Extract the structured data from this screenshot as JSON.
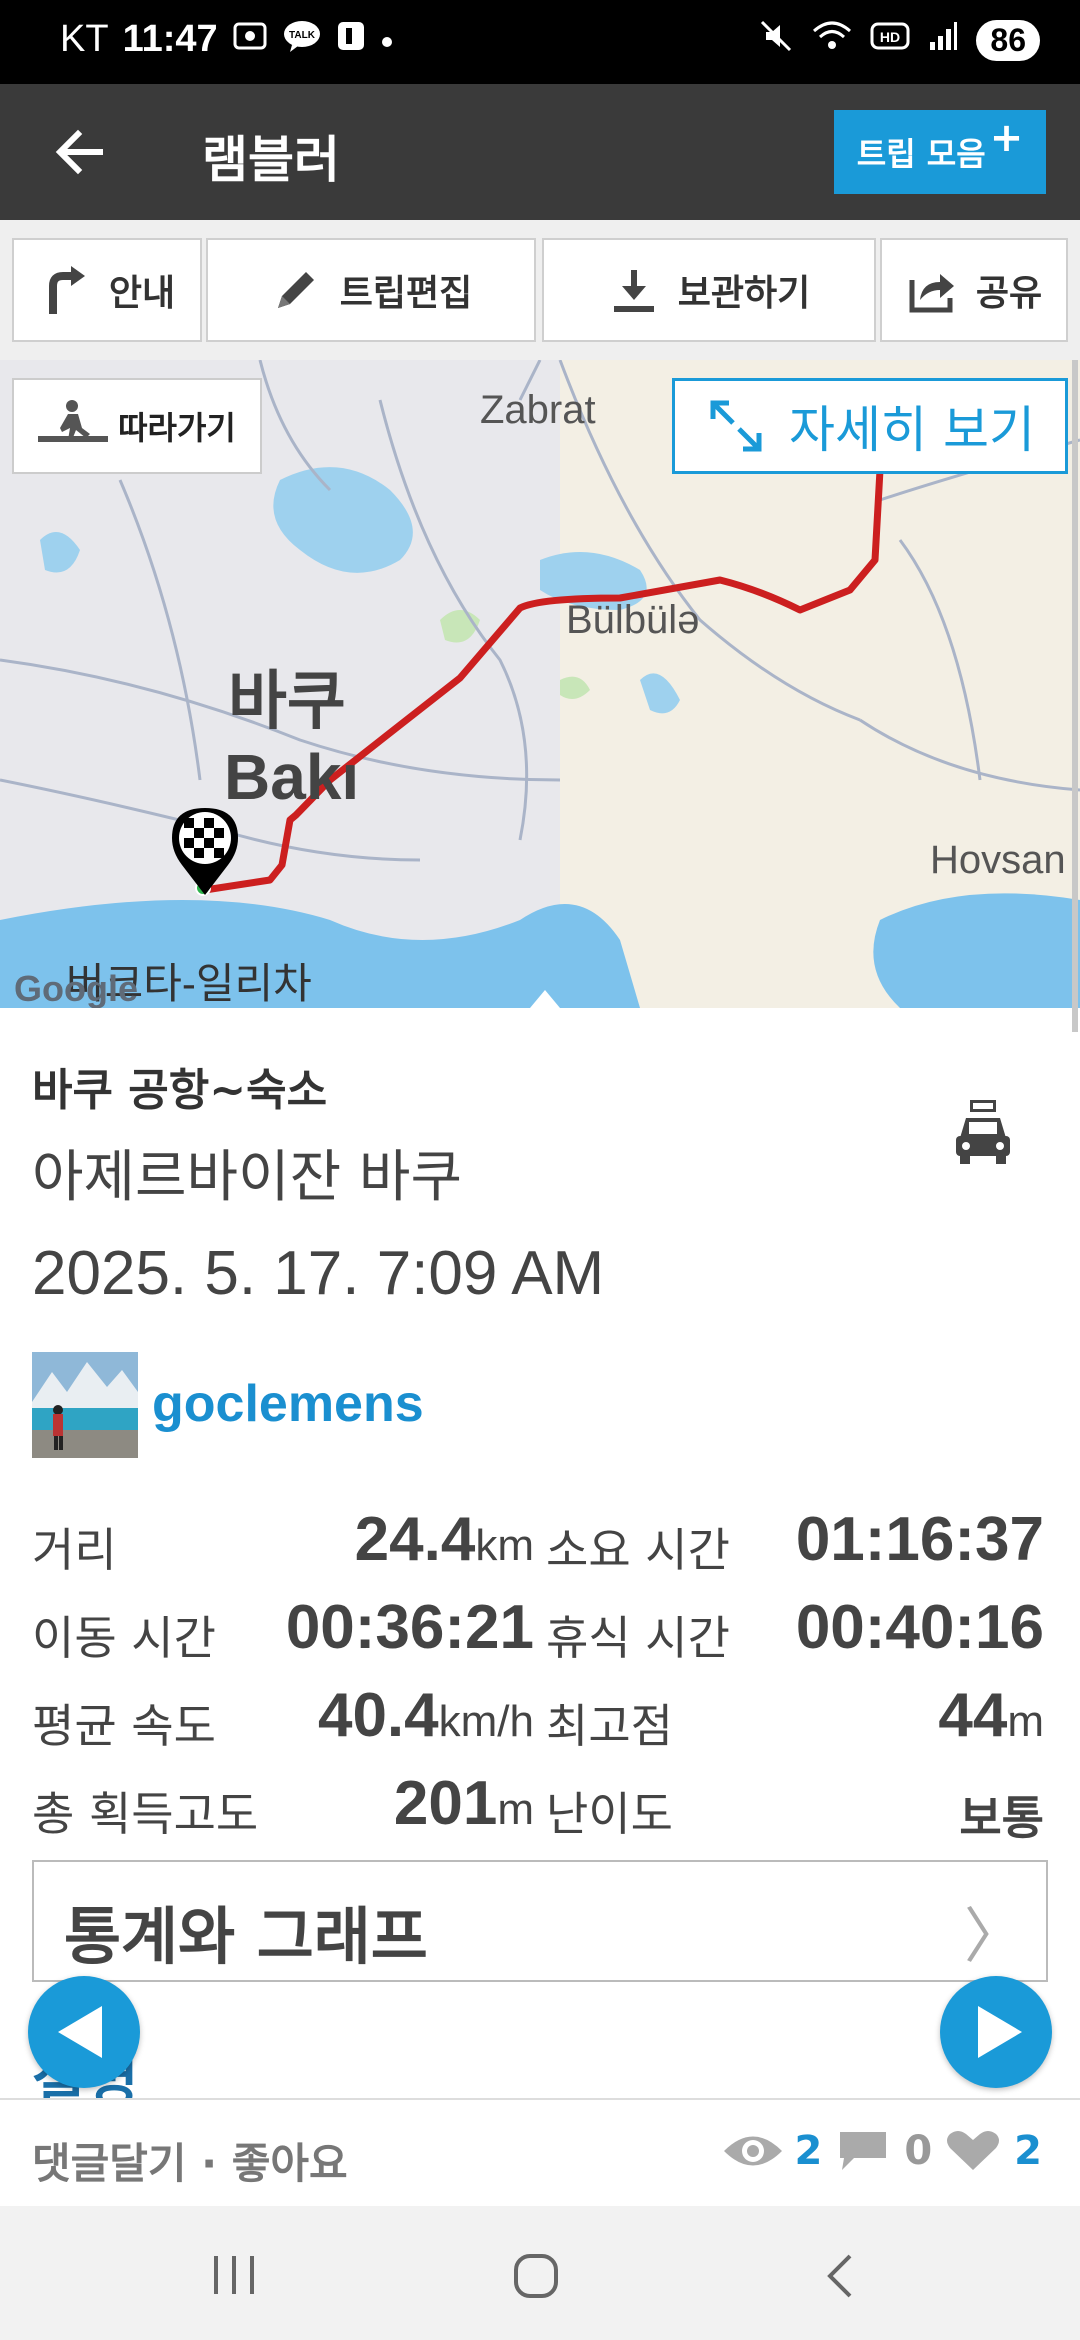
{
  "status_bar": {
    "carrier": "KT",
    "time": "11:47",
    "battery": "86",
    "notification_icons": [
      "screenshot-icon",
      "kakaotalk-icon",
      "b-app-icon",
      "dot-icon"
    ],
    "system_icons": [
      "mute-icon",
      "wifi-icon",
      "hd-icon",
      "signal-icon"
    ]
  },
  "app_bar": {
    "title": "램블러",
    "trip_collection_button": "트립 모음",
    "trip_collection_plus": "+"
  },
  "toolbar": {
    "guide": "안내",
    "edit_trip": "트립편집",
    "save": "보관하기",
    "share": "공유"
  },
  "map": {
    "follow_button": "따라가기",
    "detail_button": "자세히 보기",
    "labels": {
      "zabrat": "Zabrat",
      "bulbule": "Bülbülə",
      "baku_ko": "바쿠",
      "baku": "Bakı",
      "hovsan": "Hovsan",
      "bottom_place": "버크타-일리차",
      "google": "Google"
    },
    "route_color": "#cc1f1f"
  },
  "trip": {
    "name": "바쿠 공항~숙소",
    "location": "아제르바이잔 바쿠",
    "date": "2025. 5. 17. 7:09 AM",
    "activity_icon": "car-icon",
    "username": "goclemens"
  },
  "stats": {
    "distance_label": "거리",
    "distance_value": "24.4",
    "distance_unit": "km",
    "duration_label": "소요 시간",
    "duration_value": "01:16:37",
    "moving_label": "이동 시간",
    "moving_value": "00:36:21",
    "rest_label": "휴식 시간",
    "rest_value": "00:40:16",
    "avg_speed_label": "평균 속도",
    "avg_speed_value": "40.4",
    "avg_speed_unit": "km/h",
    "max_alt_label": "최고점",
    "max_alt_value": "44",
    "max_alt_unit": "m",
    "gain_label": "총 획득고도",
    "gain_value": "201",
    "gain_unit": "m",
    "difficulty_label": "난이도",
    "difficulty_value": "보통"
  },
  "graph_section": {
    "title": "통계와 그래프",
    "chevron": "〉"
  },
  "partial_section": {
    "title": "설명"
  },
  "bottom_bar": {
    "comment_like": "댓글달기 · 좋아요",
    "views": "2",
    "comments": "0",
    "likes": "2"
  },
  "colors": {
    "accent": "#1a9ad8",
    "appbar": "#3a3a3a",
    "username": "#1a8fd0"
  }
}
